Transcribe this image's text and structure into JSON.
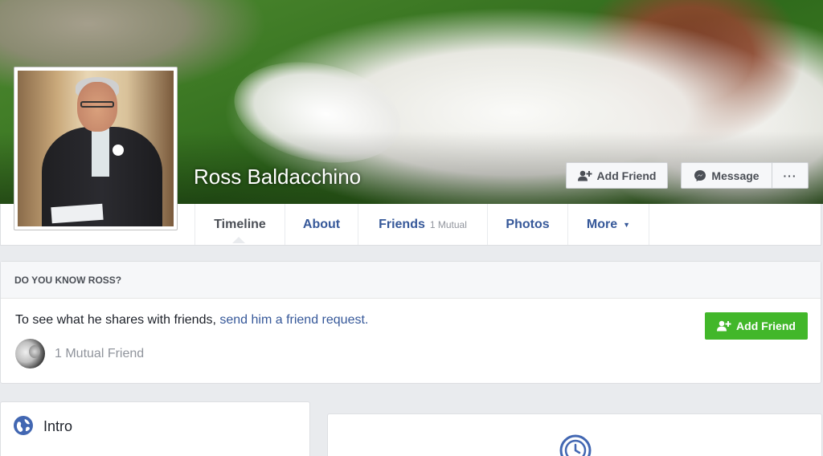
{
  "profile": {
    "name": "Ross Baldacchino"
  },
  "cover_actions": {
    "add_friend_label": "Add Friend",
    "message_label": "Message",
    "more_label": "···"
  },
  "nav": {
    "tabs": [
      {
        "label": "Timeline",
        "active": true
      },
      {
        "label": "About"
      },
      {
        "label": "Friends",
        "sub": "1 Mutual"
      },
      {
        "label": "Photos"
      },
      {
        "label": "More"
      }
    ]
  },
  "know_box": {
    "header": "DO YOU KNOW ROSS?",
    "text": "To see what he shares with friends, ",
    "link": "send him a friend request.",
    "mutual": "1 Mutual Friend",
    "add_friend_label": "Add Friend"
  },
  "intro": {
    "title": "Intro"
  },
  "icons": {
    "add_friend": "add-friend-icon",
    "messenger": "messenger-icon",
    "globe": "globe-icon",
    "clock": "clock-icon"
  },
  "colors": {
    "link": "#365899",
    "green_button": "#42b72a",
    "page_bg": "#e9ebee"
  }
}
